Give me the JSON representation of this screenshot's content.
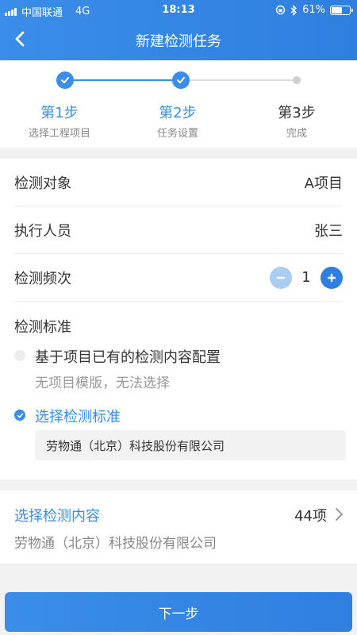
{
  "status_bar": {
    "carrier": "中国联通",
    "network": "4G",
    "time": "18:13",
    "battery": "61%",
    "battery_level": 0.61
  },
  "nav": {
    "title": "新建检测任务",
    "back_icon": "chevron-left-icon"
  },
  "steps": [
    {
      "label": "第1步",
      "sub": "选择工程项目",
      "state": "done"
    },
    {
      "label": "第2步",
      "sub": "任务设置",
      "state": "done"
    },
    {
      "label": "第3步",
      "sub": "完成",
      "state": "pending"
    }
  ],
  "form": {
    "object": {
      "label": "检测对象",
      "value": "A项目"
    },
    "executor": {
      "label": "执行人员",
      "value": "张三"
    },
    "frequency": {
      "label": "检测频次",
      "value": "1"
    },
    "standard": {
      "label": "检测标准",
      "option1": {
        "text": "基于项目已有的检测内容配置",
        "hint": "无项目模版，无法选择",
        "selected": false
      },
      "option2": {
        "text": "选择检测标准",
        "selected": true
      },
      "company": "劳物通（北京）科技股份有限公司"
    }
  },
  "content": {
    "title": "选择检测内容",
    "count": "44项",
    "company": "劳物通（北京）科技股份有限公司"
  },
  "next_button": "下一步",
  "colors": {
    "accent": "#3a8de8",
    "accent_light": "#a9cdf3",
    "background": "#f2f2f2"
  }
}
